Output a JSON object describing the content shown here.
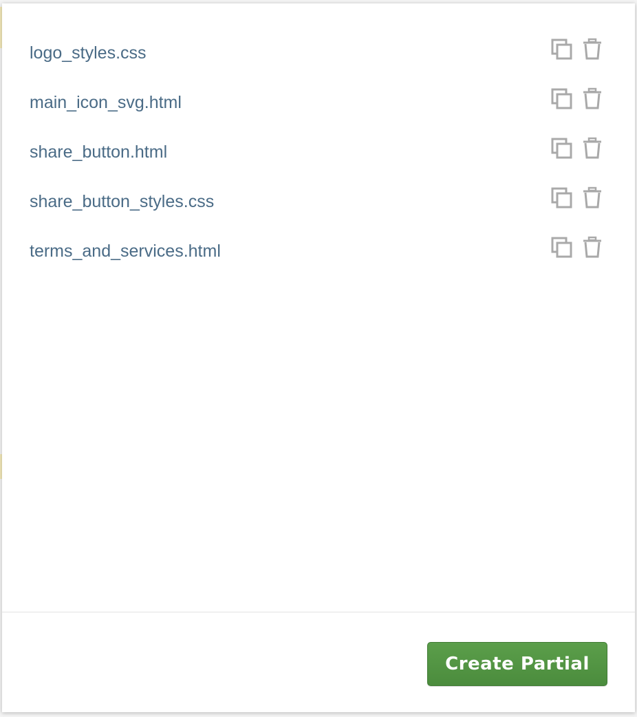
{
  "partials": {
    "items": [
      {
        "name": "logo_styles.css"
      },
      {
        "name": "main_icon_svg.html"
      },
      {
        "name": "share_button.html"
      },
      {
        "name": "share_button_styles.css"
      },
      {
        "name": "terms_and_services.html"
      }
    ],
    "item_actions": {
      "copy_icon": "copy-icon",
      "delete_icon": "trash-icon"
    }
  },
  "footer": {
    "create_label": "Create Partial"
  },
  "colors": {
    "item_text": "#4a6b86",
    "icon": "#a9a9a9",
    "primary_button": "#4f9140"
  }
}
